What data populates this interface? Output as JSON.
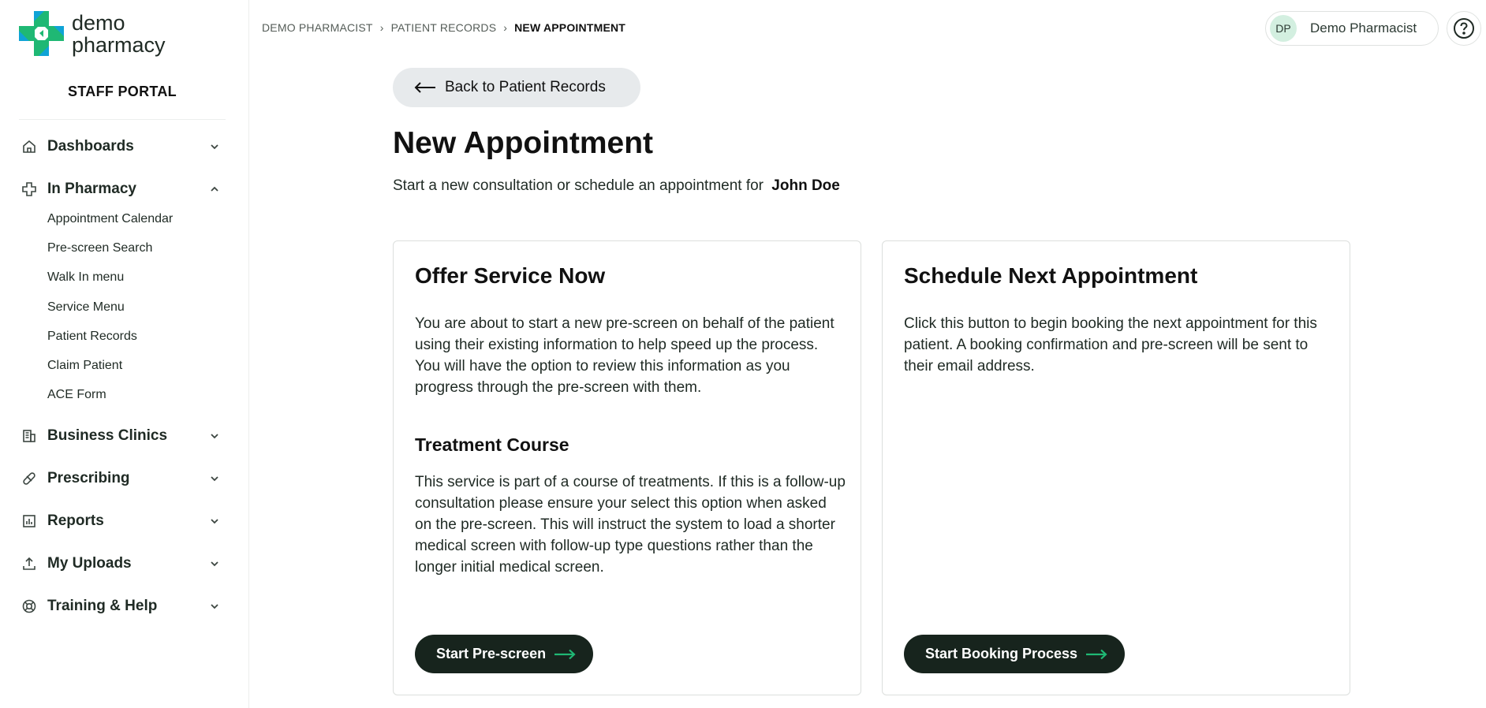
{
  "brand": {
    "line1": "demo",
    "line2": "pharmacy",
    "portal": "STAFF PORTAL",
    "colors": {
      "primary": "#1fb874",
      "accent": "#0fa3d6",
      "dark": "#17241d"
    }
  },
  "sidebar": {
    "sections": [
      {
        "label": "Dashboards",
        "icon": "home-icon",
        "expanded": false
      },
      {
        "label": "In Pharmacy",
        "icon": "medical-cross-icon",
        "expanded": true
      },
      {
        "label": "Business Clinics",
        "icon": "building-icon",
        "expanded": false
      },
      {
        "label": "Prescribing",
        "icon": "pill-icon",
        "expanded": false
      },
      {
        "label": "Reports",
        "icon": "bar-chart-icon",
        "expanded": false
      },
      {
        "label": "My Uploads",
        "icon": "upload-icon",
        "expanded": false
      },
      {
        "label": "Training & Help",
        "icon": "lifebuoy-icon",
        "expanded": false
      }
    ],
    "in_pharmacy_items": [
      "Appointment Calendar",
      "Pre-screen Search",
      "Walk In menu",
      "Service Menu",
      "Patient Records",
      "Claim Patient",
      "ACE Form"
    ]
  },
  "header": {
    "breadcrumb": [
      "DEMO PHARMACIST",
      "PATIENT RECORDS",
      "NEW APPOINTMENT"
    ],
    "user": {
      "initials": "DP",
      "name": "Demo Pharmacist"
    },
    "help_icon": "help-icon"
  },
  "main": {
    "back_label": "Back to Patient Records",
    "title": "New Appointment",
    "subtitle": "Start a new consultation or schedule an appointment for",
    "patient_name": "John Doe",
    "offer_card": {
      "title": "Offer Service Now",
      "body": "You are about to start a new pre-screen on behalf of the patient using their existing information to help speed up the process. You will have the option to review this information as you progress through the pre-screen with them.",
      "sub_title": "Treatment Course",
      "sub_body": "This service is part of a course of treatments. If this is a follow-up consultation please ensure your select this option when asked on the pre-screen. This will instruct the system to load a shorter medical screen with follow-up type questions rather than the longer initial medical screen.",
      "button": "Start Pre-screen"
    },
    "schedule_card": {
      "title": "Schedule Next Appointment",
      "body": "Click this button to begin booking the next appointment for this patient. A booking confirmation and pre-screen will be sent to their email address.",
      "button": "Start Booking Process"
    }
  }
}
